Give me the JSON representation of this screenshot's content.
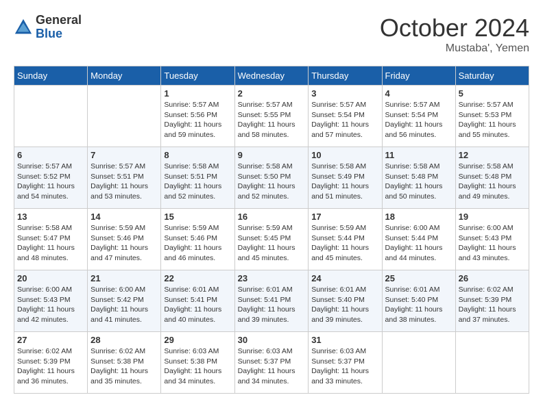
{
  "header": {
    "logo": {
      "general": "General",
      "blue": "Blue"
    },
    "title": "October 2024",
    "subtitle": "Mustaba', Yemen"
  },
  "calendar": {
    "days_of_week": [
      "Sunday",
      "Monday",
      "Tuesday",
      "Wednesday",
      "Thursday",
      "Friday",
      "Saturday"
    ],
    "weeks": [
      [
        {
          "day": "",
          "sunrise": "",
          "sunset": "",
          "daylight": ""
        },
        {
          "day": "",
          "sunrise": "",
          "sunset": "",
          "daylight": ""
        },
        {
          "day": "1",
          "sunrise": "Sunrise: 5:57 AM",
          "sunset": "Sunset: 5:56 PM",
          "daylight": "Daylight: 11 hours and 59 minutes."
        },
        {
          "day": "2",
          "sunrise": "Sunrise: 5:57 AM",
          "sunset": "Sunset: 5:55 PM",
          "daylight": "Daylight: 11 hours and 58 minutes."
        },
        {
          "day": "3",
          "sunrise": "Sunrise: 5:57 AM",
          "sunset": "Sunset: 5:54 PM",
          "daylight": "Daylight: 11 hours and 57 minutes."
        },
        {
          "day": "4",
          "sunrise": "Sunrise: 5:57 AM",
          "sunset": "Sunset: 5:54 PM",
          "daylight": "Daylight: 11 hours and 56 minutes."
        },
        {
          "day": "5",
          "sunrise": "Sunrise: 5:57 AM",
          "sunset": "Sunset: 5:53 PM",
          "daylight": "Daylight: 11 hours and 55 minutes."
        }
      ],
      [
        {
          "day": "6",
          "sunrise": "Sunrise: 5:57 AM",
          "sunset": "Sunset: 5:52 PM",
          "daylight": "Daylight: 11 hours and 54 minutes."
        },
        {
          "day": "7",
          "sunrise": "Sunrise: 5:57 AM",
          "sunset": "Sunset: 5:51 PM",
          "daylight": "Daylight: 11 hours and 53 minutes."
        },
        {
          "day": "8",
          "sunrise": "Sunrise: 5:58 AM",
          "sunset": "Sunset: 5:51 PM",
          "daylight": "Daylight: 11 hours and 52 minutes."
        },
        {
          "day": "9",
          "sunrise": "Sunrise: 5:58 AM",
          "sunset": "Sunset: 5:50 PM",
          "daylight": "Daylight: 11 hours and 52 minutes."
        },
        {
          "day": "10",
          "sunrise": "Sunrise: 5:58 AM",
          "sunset": "Sunset: 5:49 PM",
          "daylight": "Daylight: 11 hours and 51 minutes."
        },
        {
          "day": "11",
          "sunrise": "Sunrise: 5:58 AM",
          "sunset": "Sunset: 5:48 PM",
          "daylight": "Daylight: 11 hours and 50 minutes."
        },
        {
          "day": "12",
          "sunrise": "Sunrise: 5:58 AM",
          "sunset": "Sunset: 5:48 PM",
          "daylight": "Daylight: 11 hours and 49 minutes."
        }
      ],
      [
        {
          "day": "13",
          "sunrise": "Sunrise: 5:58 AM",
          "sunset": "Sunset: 5:47 PM",
          "daylight": "Daylight: 11 hours and 48 minutes."
        },
        {
          "day": "14",
          "sunrise": "Sunrise: 5:59 AM",
          "sunset": "Sunset: 5:46 PM",
          "daylight": "Daylight: 11 hours and 47 minutes."
        },
        {
          "day": "15",
          "sunrise": "Sunrise: 5:59 AM",
          "sunset": "Sunset: 5:46 PM",
          "daylight": "Daylight: 11 hours and 46 minutes."
        },
        {
          "day": "16",
          "sunrise": "Sunrise: 5:59 AM",
          "sunset": "Sunset: 5:45 PM",
          "daylight": "Daylight: 11 hours and 45 minutes."
        },
        {
          "day": "17",
          "sunrise": "Sunrise: 5:59 AM",
          "sunset": "Sunset: 5:44 PM",
          "daylight": "Daylight: 11 hours and 45 minutes."
        },
        {
          "day": "18",
          "sunrise": "Sunrise: 6:00 AM",
          "sunset": "Sunset: 5:44 PM",
          "daylight": "Daylight: 11 hours and 44 minutes."
        },
        {
          "day": "19",
          "sunrise": "Sunrise: 6:00 AM",
          "sunset": "Sunset: 5:43 PM",
          "daylight": "Daylight: 11 hours and 43 minutes."
        }
      ],
      [
        {
          "day": "20",
          "sunrise": "Sunrise: 6:00 AM",
          "sunset": "Sunset: 5:43 PM",
          "daylight": "Daylight: 11 hours and 42 minutes."
        },
        {
          "day": "21",
          "sunrise": "Sunrise: 6:00 AM",
          "sunset": "Sunset: 5:42 PM",
          "daylight": "Daylight: 11 hours and 41 minutes."
        },
        {
          "day": "22",
          "sunrise": "Sunrise: 6:01 AM",
          "sunset": "Sunset: 5:41 PM",
          "daylight": "Daylight: 11 hours and 40 minutes."
        },
        {
          "day": "23",
          "sunrise": "Sunrise: 6:01 AM",
          "sunset": "Sunset: 5:41 PM",
          "daylight": "Daylight: 11 hours and 39 minutes."
        },
        {
          "day": "24",
          "sunrise": "Sunrise: 6:01 AM",
          "sunset": "Sunset: 5:40 PM",
          "daylight": "Daylight: 11 hours and 39 minutes."
        },
        {
          "day": "25",
          "sunrise": "Sunrise: 6:01 AM",
          "sunset": "Sunset: 5:40 PM",
          "daylight": "Daylight: 11 hours and 38 minutes."
        },
        {
          "day": "26",
          "sunrise": "Sunrise: 6:02 AM",
          "sunset": "Sunset: 5:39 PM",
          "daylight": "Daylight: 11 hours and 37 minutes."
        }
      ],
      [
        {
          "day": "27",
          "sunrise": "Sunrise: 6:02 AM",
          "sunset": "Sunset: 5:39 PM",
          "daylight": "Daylight: 11 hours and 36 minutes."
        },
        {
          "day": "28",
          "sunrise": "Sunrise: 6:02 AM",
          "sunset": "Sunset: 5:38 PM",
          "daylight": "Daylight: 11 hours and 35 minutes."
        },
        {
          "day": "29",
          "sunrise": "Sunrise: 6:03 AM",
          "sunset": "Sunset: 5:38 PM",
          "daylight": "Daylight: 11 hours and 34 minutes."
        },
        {
          "day": "30",
          "sunrise": "Sunrise: 6:03 AM",
          "sunset": "Sunset: 5:37 PM",
          "daylight": "Daylight: 11 hours and 34 minutes."
        },
        {
          "day": "31",
          "sunrise": "Sunrise: 6:03 AM",
          "sunset": "Sunset: 5:37 PM",
          "daylight": "Daylight: 11 hours and 33 minutes."
        },
        {
          "day": "",
          "sunrise": "",
          "sunset": "",
          "daylight": ""
        },
        {
          "day": "",
          "sunrise": "",
          "sunset": "",
          "daylight": ""
        }
      ]
    ]
  }
}
